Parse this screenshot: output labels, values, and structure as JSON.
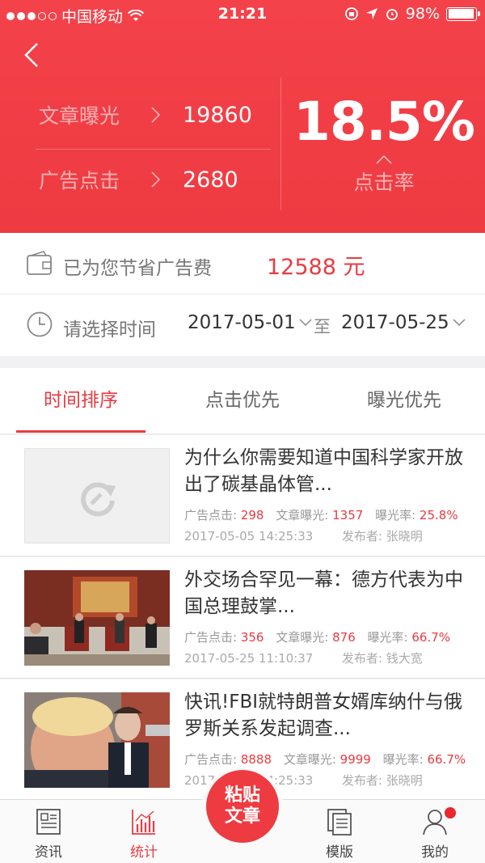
{
  "status_bar": {
    "carrier": "中国移动",
    "time": "21:21",
    "battery": "98%"
  },
  "header": {
    "article_exposure_label": "文章曝光",
    "article_exposure_value": "19860",
    "ad_click_label": "广告点击",
    "ad_click_value": "2680",
    "click_rate": "18.5%",
    "click_rate_label": "点击率"
  },
  "savings": {
    "label": "已为您节省广告费",
    "amount": "12588 元"
  },
  "time_filter": {
    "label": "请选择时间",
    "start_date": "2017-05-01",
    "to_label": "至",
    "end_date": "2017-05-25"
  },
  "sort_tabs": [
    {
      "label": "时间排序",
      "active": true
    },
    {
      "label": "点击优先",
      "active": false
    },
    {
      "label": "曝光优先",
      "active": false
    }
  ],
  "articles": [
    {
      "title": "为什么你需要知道中国科学家开放出了碳基晶体管...",
      "ad_click_label": "广告点击:",
      "ad_click": "298",
      "exposure_label": "文章曝光:",
      "exposure": "1357",
      "rate_label": "曝光率:",
      "rate": "25.8%",
      "datetime": "2017-05-05 14:25:33",
      "publisher": "发布者: 张晓明",
      "thumbnail": "placeholder-refresh-icon"
    },
    {
      "title": "外交场合罕见一幕：德方代表为中国总理鼓掌...",
      "ad_click_label": "广告点击:",
      "ad_click": "356",
      "exposure_label": "文章曝光:",
      "exposure": "876",
      "rate_label": "曝光率:",
      "rate": "66.7%",
      "datetime": "2017-05-25 11:10:37",
      "publisher": "发布者: 钱大宽",
      "thumbnail": "photo-meeting-room"
    },
    {
      "title": "快讯!FBI就特朗普女婿库纳什与俄罗斯关系发起调查...",
      "ad_click_label": "广告点击:",
      "ad_click": "8888",
      "exposure_label": "文章曝光:",
      "exposure": "9999",
      "rate_label": "曝光率:",
      "rate": "66.7%",
      "datetime": "2017-05-05 14:25:33",
      "publisher": "发布者: 张晓明",
      "thumbnail": "photo-two-men"
    }
  ],
  "tab_bar": {
    "items": [
      {
        "label": "资讯",
        "icon": "news-icon",
        "active": false
      },
      {
        "label": "统计",
        "icon": "chart-icon",
        "active": true
      },
      {
        "label": "模版",
        "icon": "template-icon",
        "active": false
      },
      {
        "label": "我的",
        "icon": "user-icon",
        "active": false
      }
    ],
    "center_button": {
      "line1": "粘贴",
      "line2": "文章"
    }
  },
  "colors": {
    "primary_red": "#ee3a41",
    "accent_red": "#e83b42"
  }
}
